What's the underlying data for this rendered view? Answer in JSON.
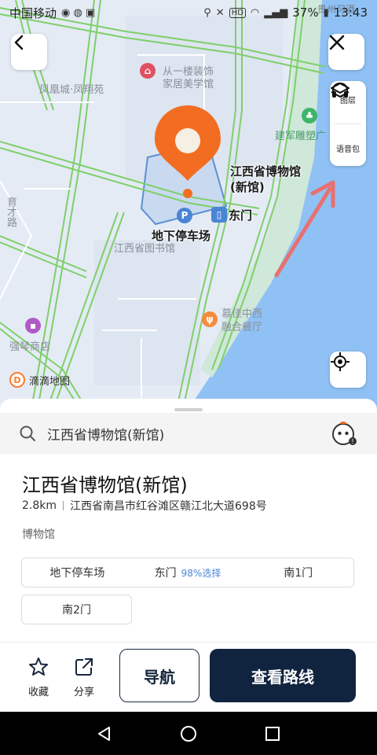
{
  "status_bar": {
    "carrier": "中国移动",
    "battery": "37%",
    "time": "13:43",
    "icons": [
      "notification-icons",
      "location-icon",
      "mute-icon",
      "hd-icon",
      "wifi-icon",
      "signal-icon",
      "battery-icon"
    ]
  },
  "map": {
    "poi_title_line1": "江西省博物馆",
    "poi_title_line2": "(新馆)",
    "parking_label": "地下停车场",
    "east_gate_label": "东门",
    "labels": {
      "fenghuangcheng": "凤凰城·凤翔苑",
      "congyilou": "从一楼装饰",
      "jiaju": "家居美学馆",
      "library": "江西省图书馆",
      "qiangqin": "强琴商店",
      "mujia_line1": "慕佳中西",
      "mujia_line2": "融合餐厅",
      "yucai": "育才路",
      "jianjun": "建军雕塑广",
      "top_right": "贵州习酒"
    },
    "buttons": {
      "layers_label": "图层",
      "voice_label": "语音包"
    },
    "brand": "滴滴地图",
    "colors": {
      "pin": "#f26d21",
      "water": "#8fc1f5",
      "park": "#cfe8d9",
      "road": "#7fcf6a"
    }
  },
  "sheet": {
    "search_text": "江西省博物馆(新馆)",
    "place_name": "江西省博物馆(新馆)",
    "distance": "2.8km",
    "address": "江西省南昌市红谷滩区赣江北大道698号",
    "category": "博物馆",
    "entrances": [
      {
        "label": "地下停车场",
        "pct": ""
      },
      {
        "label": "东门",
        "pct": "98%选择"
      },
      {
        "label": "南1门",
        "pct": ""
      }
    ],
    "extra_entrance": "南2门",
    "actions": {
      "favorite": "收藏",
      "share": "分享",
      "navigate": "导航",
      "view_route": "查看路线"
    }
  }
}
